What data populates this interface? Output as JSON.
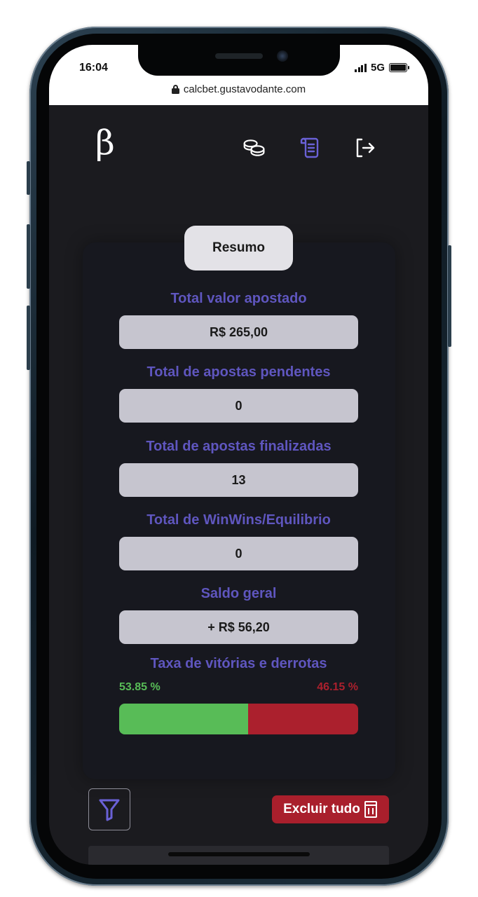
{
  "status_bar": {
    "time": "16:04",
    "network": "5G"
  },
  "browser": {
    "url": "calcbet.gustavodante.com"
  },
  "header": {
    "logo": "β",
    "icons": [
      "coins-icon",
      "scroll-icon",
      "logout-icon"
    ],
    "active_icon": "scroll-icon"
  },
  "summary": {
    "tab_label": "Resumo",
    "stats": [
      {
        "label": "Total valor apostado",
        "value": "R$ 265,00"
      },
      {
        "label": "Total de apostas pendentes",
        "value": "0"
      },
      {
        "label": "Total de apostas finalizadas",
        "value": "13"
      },
      {
        "label": "Total de WinWins/Equilibrio",
        "value": "0"
      },
      {
        "label": "Saldo geral",
        "value": "+ R$ 56,20"
      }
    ],
    "rate": {
      "label": "Taxa de vitórias e derrotas",
      "win_text": "53.85 %",
      "loss_text": "46.15 %",
      "win_percent": 53.85,
      "loss_percent": 46.15
    }
  },
  "actions": {
    "delete_all_label": "Excluir tudo"
  },
  "colors": {
    "background": "#1b1b1f",
    "card": "#17181f",
    "accent": "#5f56bf",
    "win": "#58bc57",
    "loss": "#ab202d",
    "danger_button": "#a91f2c"
  }
}
